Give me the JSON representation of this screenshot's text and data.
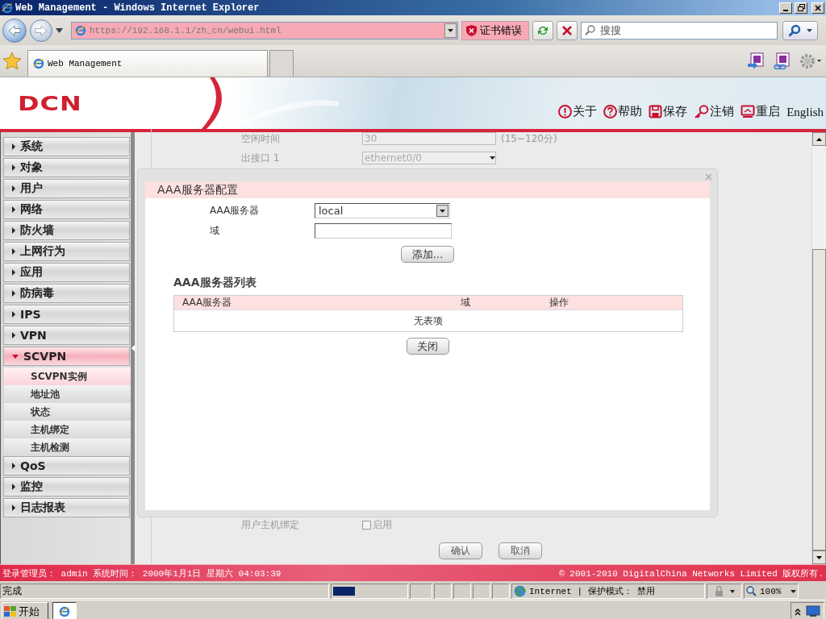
{
  "window": {
    "title": "Web Management - Windows Internet Explorer"
  },
  "address_bar": {
    "url": "https://192.168.1.1/zh_cn/webui.html",
    "cert_error": "证书错误"
  },
  "search": {
    "placeholder": "搜搜"
  },
  "tabs": [
    {
      "label": "Web Management",
      "selected": true
    }
  ],
  "header": {
    "logo": "DCN",
    "links": [
      {
        "kind": "info",
        "label": "关于"
      },
      {
        "kind": "help",
        "label": "帮助"
      },
      {
        "kind": "save",
        "label": "保存"
      },
      {
        "kind": "key",
        "label": "注销"
      },
      {
        "kind": "restart",
        "label": "重启"
      }
    ],
    "language": "English"
  },
  "sidebar": {
    "items": [
      {
        "label": "系统",
        "expanded": false,
        "selected": false
      },
      {
        "label": "对象",
        "expanded": false,
        "selected": false
      },
      {
        "label": "用户",
        "expanded": false,
        "selected": false
      },
      {
        "label": "网络",
        "expanded": false,
        "selected": false
      },
      {
        "label": "防火墙",
        "expanded": false,
        "selected": false
      },
      {
        "label": "上网行为",
        "expanded": false,
        "selected": false
      },
      {
        "label": "应用",
        "expanded": false,
        "selected": false
      },
      {
        "label": "防病毒",
        "expanded": false,
        "selected": false
      },
      {
        "label": "IPS",
        "expanded": false,
        "selected": false
      },
      {
        "label": "VPN",
        "expanded": false,
        "selected": false
      },
      {
        "label": "SCVPN",
        "expanded": true,
        "selected": true,
        "children": [
          {
            "label": "SCVPN实例",
            "selected": true
          },
          {
            "label": "地址池",
            "selected": false
          },
          {
            "label": "状态",
            "selected": false
          },
          {
            "label": "主机绑定",
            "selected": false
          },
          {
            "label": "主机检测",
            "selected": false
          }
        ]
      },
      {
        "label": "QoS",
        "expanded": false,
        "selected": false
      },
      {
        "label": "监控",
        "expanded": false,
        "selected": false
      },
      {
        "label": "日志报表",
        "expanded": false,
        "selected": false
      }
    ]
  },
  "background_form": {
    "rows": [
      {
        "kind": "text",
        "label": "空闲时间",
        "value": "30",
        "hint": "(15~120分)"
      },
      {
        "kind": "select",
        "label": "出接口 1",
        "value": "ethernet0/0"
      }
    ],
    "binding": {
      "label": "用户主机绑定",
      "option": "启用",
      "checked": false
    },
    "buttons": [
      "确认",
      "取消"
    ]
  },
  "dialog": {
    "section_title": "AAA服务器配置",
    "fields": [
      {
        "kind": "select",
        "label": "AAA服务器",
        "value": "local"
      },
      {
        "kind": "text",
        "label": "域"
      }
    ],
    "add_button": "添加...",
    "list_title": "AAA服务器列表",
    "table": {
      "columns": [
        "AAA服务器",
        "域",
        "操作"
      ],
      "empty": "无表项"
    },
    "close_button": "关闭"
  },
  "footer": {
    "login": "登录管理员： admin 系统时间： 2000年1月1日 星期六 04:03:39",
    "copyright": "© 2001-2010 DigitalChina Networks Limited 版权所有."
  },
  "status_bar": {
    "text": "完成",
    "level": 0.3,
    "zone": "Internet | 保护模式： 禁用",
    "zoom": "100%"
  },
  "taskbar": {
    "start": "开始"
  }
}
